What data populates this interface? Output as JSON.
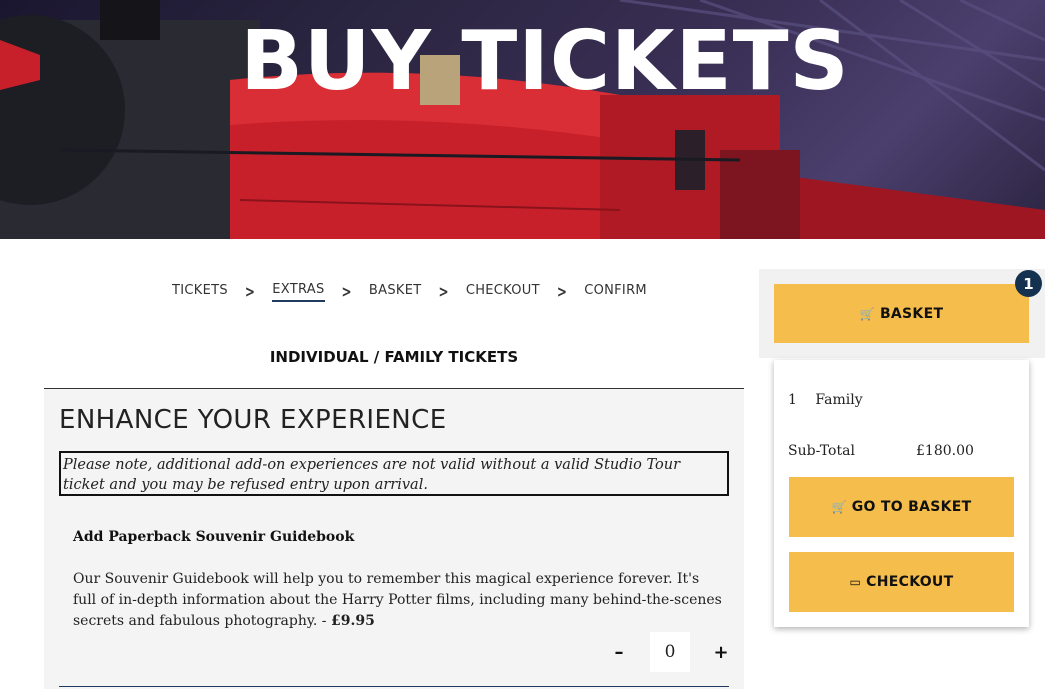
{
  "hero": {
    "title": "BUY TICKETS"
  },
  "breadcrumb": [
    {
      "label": "TICKETS",
      "active": false
    },
    {
      "label": "EXTRAS",
      "active": true
    },
    {
      "label": "BASKET",
      "active": false
    },
    {
      "label": "CHECKOUT",
      "active": false
    },
    {
      "label": "CONFIRM",
      "active": false
    }
  ],
  "ticket_type": "INDIVIDUAL / FAMILY TICKETS",
  "panel": {
    "heading": "ENHANCE YOUR EXPERIENCE",
    "notice": "Please note, additional add-on experiences are not valid without a valid Studio Tour ticket and you may be refused entry upon arrival.",
    "addon": {
      "title": "Add Paperback Souvenir Guidebook",
      "description": "Our Souvenir Guidebook will help you to remember this magical experience forever. It's full of in-depth information about the Harry Potter films, including many behind-the-scenes secrets and fabulous photography. - ",
      "price": "£9.95",
      "quantity": "0",
      "minus_label": "–",
      "plus_label": "+"
    }
  },
  "sidebar": {
    "basket_label": "BASKET",
    "badge_count": "1",
    "item_qty": "1",
    "item_name": "Family",
    "subtotal_label": "Sub-Total",
    "subtotal_value": "£180.00",
    "go_to_basket_label": "GO TO BASKET",
    "checkout_label": "CHECKOUT"
  },
  "colors": {
    "accent": "#f5bd4b",
    "navy": "#14324f",
    "panel_bg": "#f4f4f4"
  },
  "icons": {
    "basket": "cart-icon",
    "checkout": "card-icon"
  }
}
